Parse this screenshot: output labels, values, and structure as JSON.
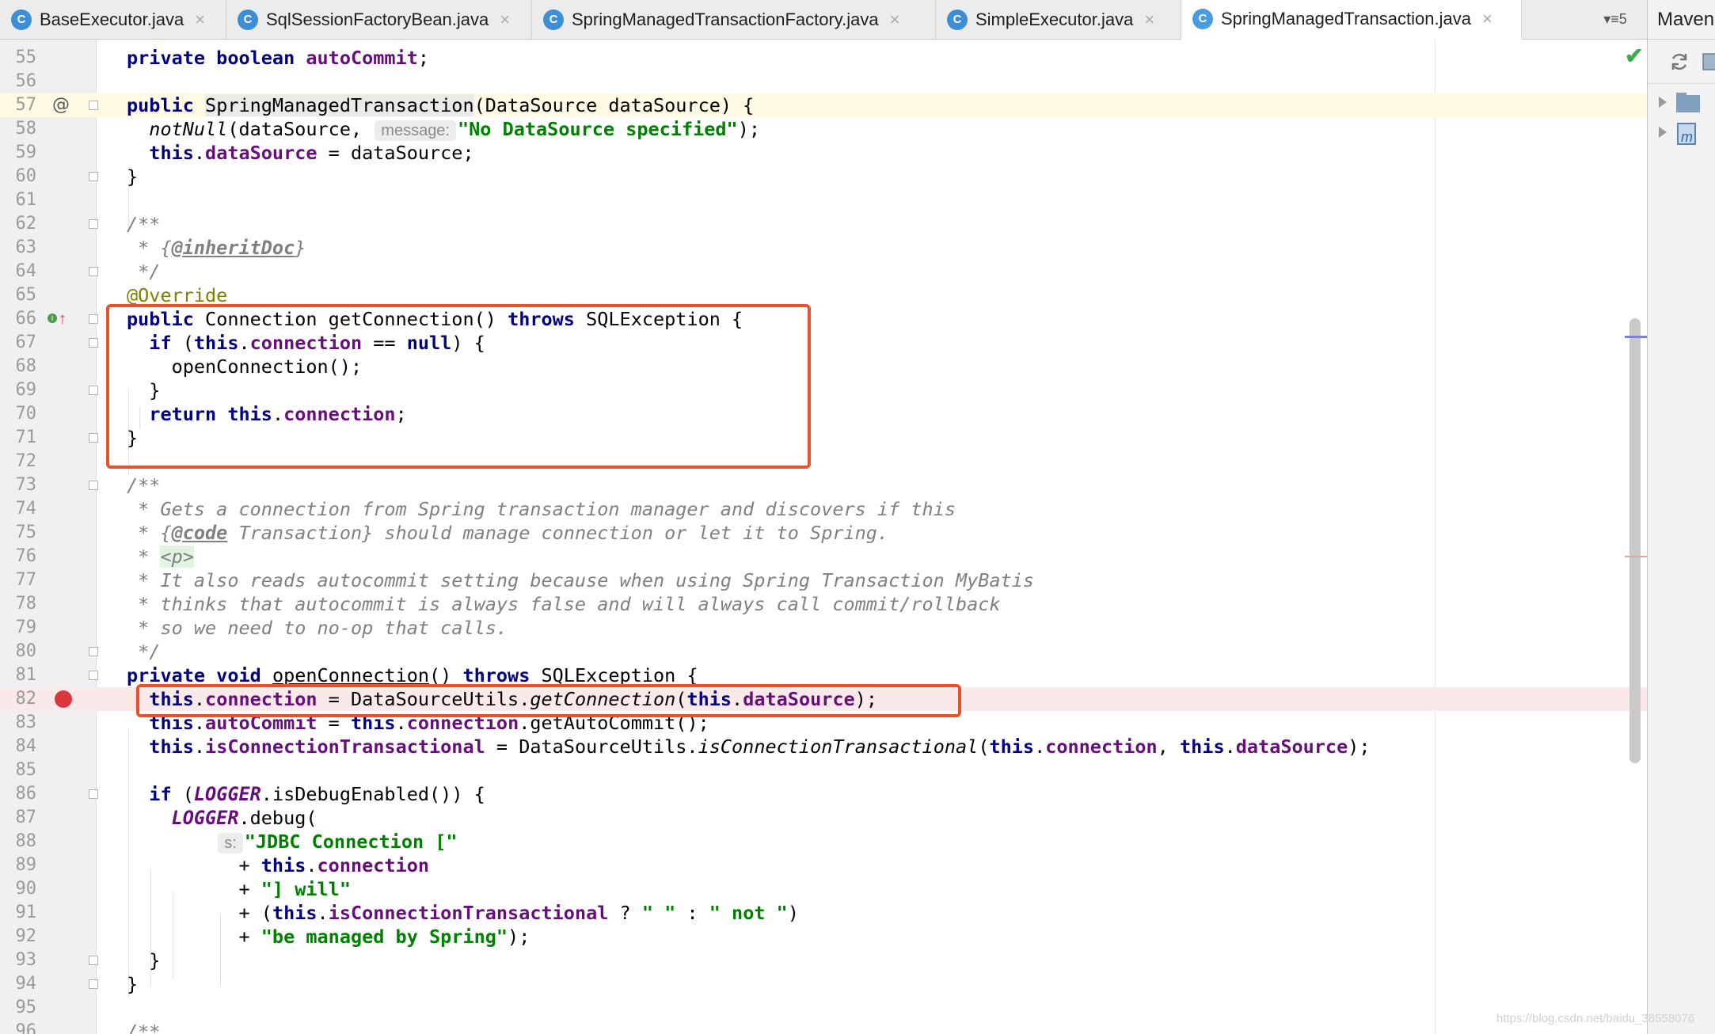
{
  "tabs": [
    {
      "label": "BaseExecutor.java",
      "icon": "C",
      "active": false
    },
    {
      "label": "SqlSessionFactoryBean.java",
      "icon": "C",
      "active": false
    },
    {
      "label": "SpringManagedTransactionFactory.java",
      "icon": "C",
      "active": false
    },
    {
      "label": "SimpleExecutor.java",
      "icon": "C",
      "active": false
    },
    {
      "label": "SpringManagedTransaction.java",
      "icon": "C",
      "active": true
    }
  ],
  "tab_overflow_count": "5",
  "right_panel": {
    "title": "Maven"
  },
  "watermark": "https://blog.csdn.net/baidu_38558076",
  "colors": {
    "highlight_box": "#e8512a",
    "breakpoint": "#d9363e",
    "caret_line": "#fffae3"
  },
  "code": {
    "first_line": 55,
    "caret_line": 57,
    "breakpoint_line": 82,
    "override_line": 66,
    "lines": [
      [
        [
          "k",
          "private boolean "
        ],
        [
          "f",
          "autoCommit"
        ],
        [
          "",
          "; "
        ]
      ],
      [],
      [
        [
          "k",
          "public "
        ],
        [
          "hl",
          "SpringManagedTransaction"
        ],
        [
          "",
          "(DataSource dataSource) {"
        ]
      ],
      [
        [
          "",
          "  "
        ],
        [
          "i",
          "notNull"
        ],
        [
          "",
          "(dataSource, "
        ],
        [
          "hint",
          "message:"
        ],
        [
          "s",
          "\"No DataSource specified\""
        ],
        [
          "",
          ");"
        ]
      ],
      [
        [
          "",
          "  "
        ],
        [
          "k",
          "this"
        ],
        [
          "",
          "."
        ],
        [
          "f",
          "dataSource"
        ],
        [
          "",
          " = dataSource;"
        ]
      ],
      [
        [
          "",
          "}"
        ]
      ],
      [],
      [
        [
          "c",
          "/**"
        ]
      ],
      [
        [
          "c",
          " * {"
        ],
        [
          "ct",
          "@inheritDoc"
        ],
        [
          "c",
          "}"
        ]
      ],
      [
        [
          "c",
          " */"
        ]
      ],
      [
        [
          "a",
          "@Override"
        ]
      ],
      [
        [
          "k",
          "public "
        ],
        [
          "",
          "Connection getConnection() "
        ],
        [
          "k",
          "throws "
        ],
        [
          "",
          "SQLException {"
        ]
      ],
      [
        [
          "",
          "  "
        ],
        [
          "k",
          "if "
        ],
        [
          "",
          "("
        ],
        [
          "k",
          "this"
        ],
        [
          "",
          "."
        ],
        [
          "f",
          "connection"
        ],
        [
          "",
          " == "
        ],
        [
          "k",
          "null"
        ],
        [
          "",
          ") {"
        ]
      ],
      [
        [
          "",
          "    openConnection();"
        ]
      ],
      [
        [
          "",
          "  }"
        ]
      ],
      [
        [
          "",
          "  "
        ],
        [
          "k",
          "return this"
        ],
        [
          "",
          "."
        ],
        [
          "f",
          "connection"
        ],
        [
          "",
          ";"
        ]
      ],
      [
        [
          "",
          "}"
        ]
      ],
      [],
      [
        [
          "c",
          "/**"
        ]
      ],
      [
        [
          "c",
          " * Gets a connection from Spring transaction manager and discovers if this"
        ]
      ],
      [
        [
          "c",
          " * {"
        ],
        [
          "ct",
          "@code"
        ],
        [
          "c",
          " Transaction} should manage connection or let it to Spring."
        ]
      ],
      [
        [
          "c",
          " * "
        ],
        [
          "ch",
          "<p>"
        ]
      ],
      [
        [
          "c",
          " * It also reads autocommit setting because when using Spring Transaction MyBatis"
        ]
      ],
      [
        [
          "c",
          " * thinks that autocommit is always false and will always call commit/rollback"
        ]
      ],
      [
        [
          "c",
          " * so we need to no-op that calls."
        ]
      ],
      [
        [
          "c",
          " */"
        ]
      ],
      [
        [
          "k",
          "private void "
        ],
        [
          "u",
          "openConnection"
        ],
        [
          "",
          "() "
        ],
        [
          "k",
          "throws "
        ],
        [
          "",
          "SQLException {"
        ]
      ],
      [
        [
          "",
          "  "
        ],
        [
          "k",
          "this"
        ],
        [
          "",
          "."
        ],
        [
          "f",
          "connection"
        ],
        [
          "",
          " = DataSourceUtils."
        ],
        [
          "i",
          "getConnection"
        ],
        [
          "",
          "("
        ],
        [
          "k",
          "this"
        ],
        [
          "",
          "."
        ],
        [
          "f",
          "dataSource"
        ],
        [
          "",
          ");"
        ]
      ],
      [
        [
          "",
          "  "
        ],
        [
          "k",
          "this"
        ],
        [
          "",
          "."
        ],
        [
          "f",
          "autoCommit"
        ],
        [
          "",
          " = "
        ],
        [
          "k",
          "this"
        ],
        [
          "",
          "."
        ],
        [
          "f",
          "connection"
        ],
        [
          "",
          ".getAutoCommit();"
        ]
      ],
      [
        [
          "",
          "  "
        ],
        [
          "k",
          "this"
        ],
        [
          "",
          "."
        ],
        [
          "f",
          "isConnectionTransactional"
        ],
        [
          "",
          " = DataSourceUtils."
        ],
        [
          "i",
          "isConnectionTransactional"
        ],
        [
          "",
          "("
        ],
        [
          "k",
          "this"
        ],
        [
          "",
          "."
        ],
        [
          "f",
          "connection"
        ],
        [
          "",
          ", "
        ],
        [
          "k",
          "this"
        ],
        [
          "",
          "."
        ],
        [
          "f",
          "dataSource"
        ],
        [
          "",
          ");"
        ]
      ],
      [],
      [
        [
          "",
          "  "
        ],
        [
          "k",
          "if "
        ],
        [
          "",
          "("
        ],
        [
          "fi",
          "LOGGER"
        ],
        [
          "",
          ".isDebugEnabled()) {"
        ]
      ],
      [
        [
          "",
          "    "
        ],
        [
          "fi",
          "LOGGER"
        ],
        [
          "",
          ".debug("
        ]
      ],
      [
        [
          "",
          "        "
        ],
        [
          "hint",
          "s:"
        ],
        [
          "s",
          "\"JDBC Connection [\""
        ]
      ],
      [
        [
          "",
          "          + "
        ],
        [
          "k",
          "this"
        ],
        [
          "",
          "."
        ],
        [
          "f",
          "connection"
        ]
      ],
      [
        [
          "",
          "          + "
        ],
        [
          "s",
          "\"] will\""
        ]
      ],
      [
        [
          "",
          "          + ("
        ],
        [
          "k",
          "this"
        ],
        [
          "",
          "."
        ],
        [
          "f",
          "isConnectionTransactional"
        ],
        [
          "",
          " ? "
        ],
        [
          "s",
          "\" \""
        ],
        [
          "",
          " : "
        ],
        [
          "s",
          "\" not \""
        ],
        [
          "",
          ")"
        ]
      ],
      [
        [
          "",
          "          + "
        ],
        [
          "s",
          "\"be managed by Spring\""
        ],
        [
          "",
          ");"
        ]
      ],
      [
        [
          "",
          "  }"
        ]
      ],
      [
        [
          "",
          "}"
        ]
      ],
      [],
      [
        [
          "c",
          "/**"
        ]
      ]
    ]
  }
}
